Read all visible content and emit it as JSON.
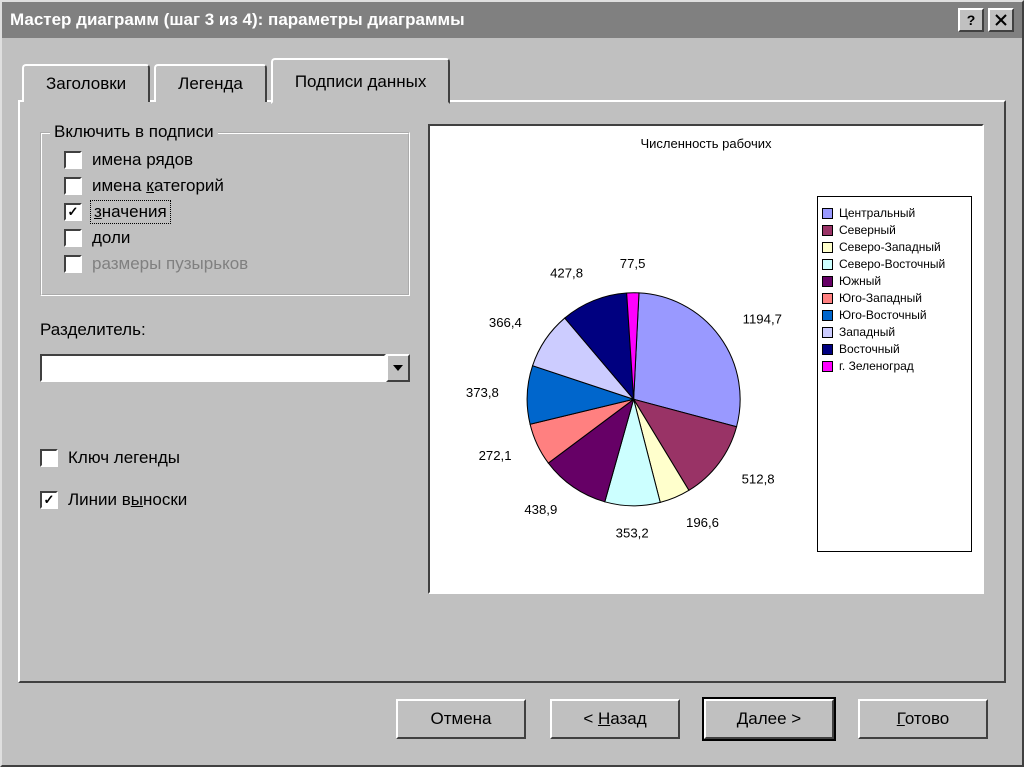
{
  "window": {
    "title": "Мастер диаграмм (шаг 3 из 4): параметры диаграммы"
  },
  "tabs": {
    "headers": "Заголовки",
    "legend": "Легенда",
    "datalabels": "Подписи данных"
  },
  "group": {
    "title": "Включить в подписи",
    "series_names": "имена рядов",
    "category_names_pre": "имена ",
    "category_names_key": "к",
    "category_names_post": "атегорий",
    "values_key": "з",
    "values_post": "начения",
    "percentages_key": "д",
    "percentages_post": "оли",
    "bubble_sizes": "размеры пузырьков"
  },
  "separator": {
    "label_pre": "Раз",
    "label_key": "д",
    "label_post": "елитель:",
    "value": ""
  },
  "extra": {
    "legend_key": "Ключ легенды",
    "leader_lines_pre": "Линии в",
    "leader_lines_key": "ы",
    "leader_lines_post": "носки"
  },
  "buttons": {
    "cancel": "Отмена",
    "back_pre": "< ",
    "back_key": "Н",
    "back_post": "азад",
    "next_pre": "",
    "next_key": "Д",
    "next_post": "алее >",
    "finish_key": "Г",
    "finish_post": "отово"
  },
  "chart_data": {
    "type": "pie",
    "title": "Численность рабочих",
    "series": [
      {
        "name": "Центральный",
        "value": 1194.7,
        "color": "#9999ff"
      },
      {
        "name": "Северный",
        "value": 512.8,
        "color": "#993366"
      },
      {
        "name": "Северо-Западный",
        "value": 196.6,
        "color": "#ffffcc"
      },
      {
        "name": "Северо-Восточный",
        "value": 353.2,
        "color": "#ccffff"
      },
      {
        "name": "Южный",
        "value": 438.9,
        "color": "#660066"
      },
      {
        "name": "Юго-Западный",
        "value": 272.1,
        "color": "#ff8080"
      },
      {
        "name": "Юго-Восточный",
        "value": 373.8,
        "color": "#0066cc"
      },
      {
        "name": "Западный",
        "value": 366.4,
        "color": "#ccccff"
      },
      {
        "name": "Восточный",
        "value": 427.8,
        "color": "#000080"
      },
      {
        "name": "г. Зеленоград",
        "value": 77.5,
        "color": "#ff00ff"
      }
    ]
  }
}
